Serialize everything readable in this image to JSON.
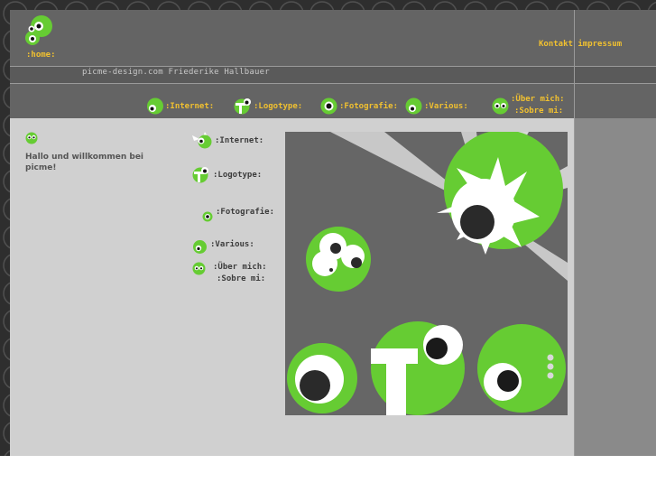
{
  "header": {
    "home_label": ":home:",
    "site_name": "picme-design.com  Friederike Hallbauer",
    "links": {
      "contact": "Kontakt",
      "imprint": "impressum"
    }
  },
  "nav": {
    "items": [
      {
        "label": ":Internet:",
        "icon": "internet-monster-icon"
      },
      {
        "label": ":Logotype:",
        "icon": "logotype-monster-icon"
      },
      {
        "label": ":Fotografie:",
        "icon": "fotografie-monster-icon"
      },
      {
        "label": ":Various:",
        "icon": "various-monster-icon"
      },
      {
        "label_line1": ":Über mich:",
        "label_line2": ":Sobre mi:",
        "icon": "about-monster-icon"
      }
    ]
  },
  "main": {
    "welcome_text": "Hallo und willkommen bei picme!",
    "side_items": [
      {
        "label": ":Internet:"
      },
      {
        "label": ":Logotype:"
      },
      {
        "label": ":Fotografie:"
      },
      {
        "label": ":Various:"
      },
      {
        "label_line1": ":Über mich:",
        "label_line2": ":Sobre mi:"
      }
    ]
  },
  "colors": {
    "accent": "#f0c030",
    "green": "#66cc33",
    "header_bg": "#646464",
    "content_bg": "#d0d0d0"
  }
}
